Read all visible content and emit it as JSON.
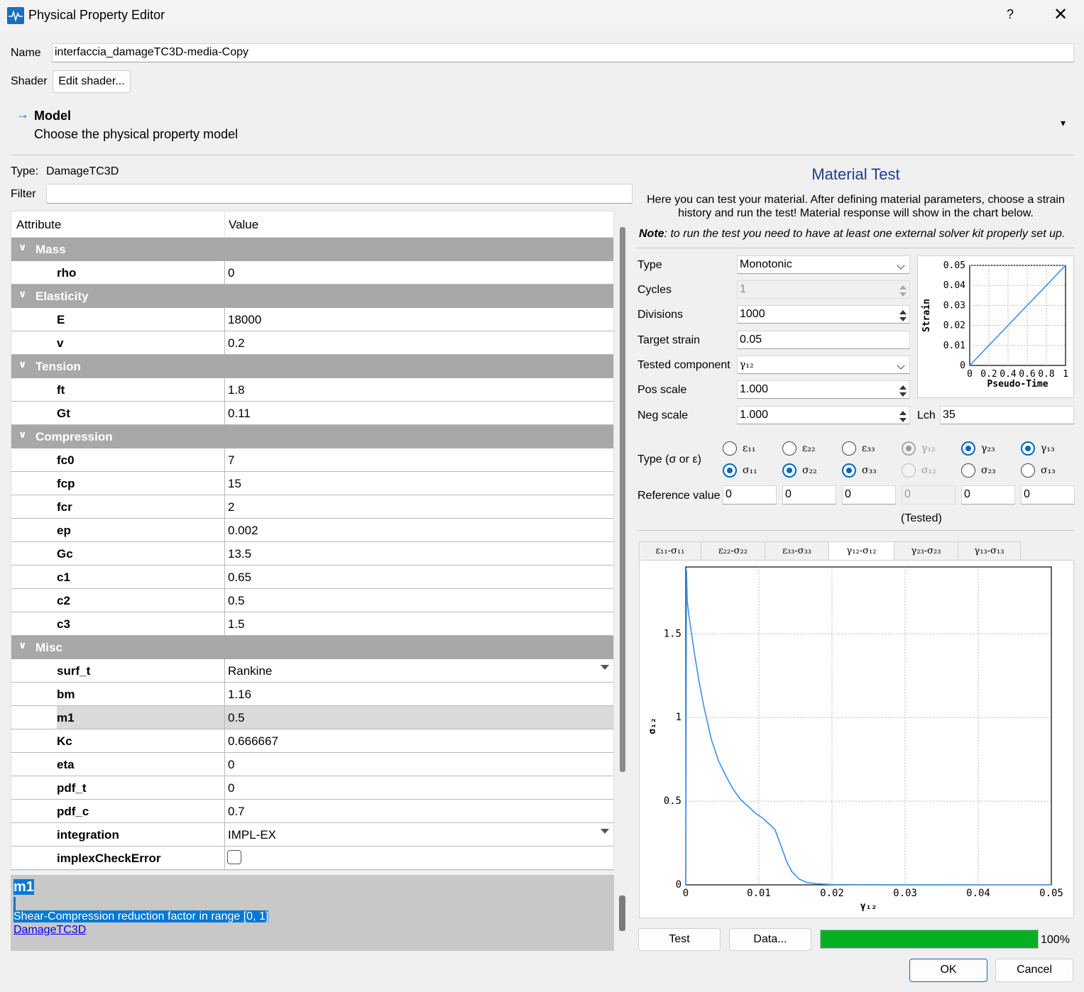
{
  "window": {
    "title": "Physical Property Editor",
    "help": "?",
    "close": "✕"
  },
  "name_label": "Name",
  "name_value": "interfaccia_damageTC3D-media-Copy",
  "shader_label": "Shader",
  "shader_button": "Edit shader...",
  "model": {
    "arrow": "→",
    "title": "Model",
    "subtitle": "Choose the physical property model",
    "caret": "▾"
  },
  "type_label": "Type:",
  "type_value": "DamageTC3D",
  "filter_label": "Filter",
  "filter_value": "",
  "grid": {
    "col_attribute": "Attribute",
    "col_value": "Value",
    "rows": [
      {
        "kind": "group",
        "name": "Mass"
      },
      {
        "kind": "attr",
        "name": "rho",
        "value": "0"
      },
      {
        "kind": "group",
        "name": "Elasticity"
      },
      {
        "kind": "attr",
        "name": "E",
        "value": "18000"
      },
      {
        "kind": "attr",
        "name": "v",
        "value": "0.2"
      },
      {
        "kind": "group",
        "name": "Tension"
      },
      {
        "kind": "attr",
        "name": "ft",
        "value": "1.8"
      },
      {
        "kind": "attr",
        "name": "Gt",
        "value": "0.11"
      },
      {
        "kind": "group",
        "name": "Compression"
      },
      {
        "kind": "attr",
        "name": "fc0",
        "value": "7"
      },
      {
        "kind": "attr",
        "name": "fcp",
        "value": "15"
      },
      {
        "kind": "attr",
        "name": "fcr",
        "value": "2"
      },
      {
        "kind": "attr",
        "name": "ep",
        "value": "0.002"
      },
      {
        "kind": "attr",
        "name": "Gc",
        "value": "13.5"
      },
      {
        "kind": "attr",
        "name": "c1",
        "value": "0.65"
      },
      {
        "kind": "attr",
        "name": "c2",
        "value": "0.5"
      },
      {
        "kind": "attr",
        "name": "c3",
        "value": "1.5"
      },
      {
        "kind": "group",
        "name": "Misc"
      },
      {
        "kind": "attr",
        "name": "surf_t",
        "value": "Rankine",
        "dropdown": true
      },
      {
        "kind": "attr",
        "name": "bm",
        "value": "1.16"
      },
      {
        "kind": "attr",
        "name": "m1",
        "value": "0.5",
        "selected": true
      },
      {
        "kind": "attr",
        "name": "Kc",
        "value": "0.666667"
      },
      {
        "kind": "attr",
        "name": "eta",
        "value": "0"
      },
      {
        "kind": "attr",
        "name": "pdf_t",
        "value": "0"
      },
      {
        "kind": "attr",
        "name": "pdf_c",
        "value": "0.7"
      },
      {
        "kind": "attr",
        "name": "integration",
        "value": "IMPL-EX",
        "dropdown": true
      },
      {
        "kind": "attr",
        "name": "implexCheckError",
        "value": "",
        "checkbox": true,
        "checked": false
      }
    ]
  },
  "info": {
    "title": "m1",
    "description": "Shear-Compression reduction factor in range [0, 1]",
    "link": "DamageTC3D"
  },
  "material_test": {
    "title": "Material Test",
    "intro": "Here you can test your material. After defining material parameters, choose a strain history and run the test! Material response will show in the chart below.",
    "note_label": "Note",
    "note_text": ": to run the test you need to have at least one external solver kit properly set up.",
    "type_label": "Type",
    "type_value": "Monotonic",
    "cycles_label": "Cycles",
    "cycles_value": "1",
    "divisions_label": "Divisions",
    "divisions_value": "1000",
    "target_label": "Target strain",
    "target_value": "0.05",
    "component_label": "Tested component",
    "component_value": "γ₁₂",
    "pos_label": "Pos scale",
    "pos_value": "1.000",
    "neg_label": "Neg scale",
    "neg_value": "1.000",
    "lch_label": "Lch",
    "lch_value": "35",
    "type_sigma_label": "Type (σ or ε)",
    "reference_label": "Reference value",
    "tested_label": "(Tested)",
    "components": [
      {
        "eps": "ε₁₁",
        "sig": "σ₁₁",
        "eps_on": false,
        "sig_on": true,
        "disabled": false,
        "ref": "0"
      },
      {
        "eps": "ε₂₂",
        "sig": "σ₂₂",
        "eps_on": false,
        "sig_on": true,
        "disabled": false,
        "ref": "0"
      },
      {
        "eps": "ε₃₃",
        "sig": "σ₃₃",
        "eps_on": false,
        "sig_on": true,
        "disabled": false,
        "ref": "0"
      },
      {
        "eps": "γ₁₂",
        "sig": "σ₁₂",
        "eps_on": true,
        "sig_on": false,
        "disabled": true,
        "ref": "0"
      },
      {
        "eps": "γ₂₃",
        "sig": "σ₂₃",
        "eps_on": true,
        "sig_on": false,
        "disabled": false,
        "ref": "0"
      },
      {
        "eps": "γ₁₃",
        "sig": "σ₁₃",
        "eps_on": true,
        "sig_on": false,
        "disabled": false,
        "ref": "0"
      }
    ],
    "tabs": [
      "ε₁₁-σ₁₁",
      "ε₂₂-σ₂₂",
      "ε₃₃-σ₃₃",
      "γ₁₂-σ₁₂",
      "γ₂₃-σ₂₃",
      "γ₁₃-σ₁₃"
    ],
    "active_tab": 3,
    "test_button": "Test",
    "data_button": "Data...",
    "progress": 100,
    "progress_label": "100%"
  },
  "buttons": {
    "ok": "OK",
    "cancel": "Cancel"
  },
  "colors": {
    "accent": "#0067c0",
    "line": "#3d8fe6",
    "progress": "#06b025",
    "group": "#a8a8a8"
  },
  "chart_data": [
    {
      "type": "line",
      "title": "",
      "xlabel": "Pseudo-Time",
      "ylabel": "Strain",
      "xlim": [
        0,
        1
      ],
      "ylim": [
        0,
        0.05
      ],
      "x_ticks": [
        "0",
        "0.2",
        "0.4",
        "0.6",
        "0.8",
        "1"
      ],
      "y_ticks": [
        "0",
        "0.01",
        "0.02",
        "0.03",
        "0.04",
        "0.05"
      ],
      "grid": true,
      "series": [
        {
          "x": [
            0,
            1
          ],
          "y": [
            0,
            0.05
          ]
        }
      ]
    },
    {
      "type": "line",
      "title": "",
      "xlabel": "γ₁₂",
      "ylabel": "σ₁₂",
      "xlim": [
        0,
        0.05
      ],
      "ylim": [
        0,
        1.9
      ],
      "x_ticks": [
        "0",
        "0.01",
        "0.02",
        "0.03",
        "0.04",
        "0.05"
      ],
      "y_ticks": [
        "0",
        "0.5",
        "1",
        "1.5"
      ],
      "grid": true,
      "series": [
        {
          "x": [
            0,
            0.0001,
            0.0002,
            0.0004,
            0.0008,
            0.0012,
            0.0018,
            0.0025,
            0.0035,
            0.0045,
            0.0055,
            0.0065,
            0.0075,
            0.0085,
            0.0095,
            0.0105,
            0.0115,
            0.0122,
            0.0128,
            0.0133,
            0.0138,
            0.0145,
            0.0155,
            0.0165,
            0.018,
            0.02,
            0.025,
            0.03,
            0.035,
            0.04,
            0.045,
            0.05
          ],
          "y": [
            0,
            1.88,
            1.7,
            1.62,
            1.5,
            1.38,
            1.22,
            1.06,
            0.87,
            0.74,
            0.65,
            0.57,
            0.51,
            0.47,
            0.43,
            0.4,
            0.36,
            0.33,
            0.26,
            0.2,
            0.14,
            0.08,
            0.035,
            0.015,
            0.006,
            0.002,
            0.001,
            0.0005,
            0.0003,
            0.0002,
            0.0001,
            0.0001
          ]
        }
      ]
    }
  ]
}
